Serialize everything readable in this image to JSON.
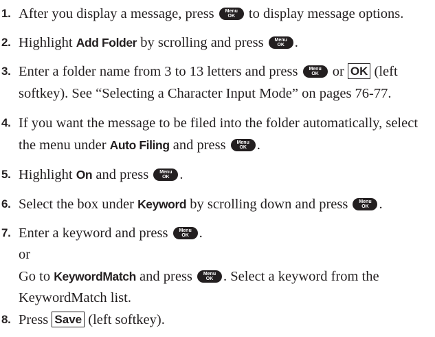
{
  "key": {
    "icon": "menu-ok-key-icon",
    "top": "Menu",
    "bottom": "OK"
  },
  "steps": [
    {
      "number": "1.",
      "t1": "After you display a message, press",
      "t2": "to display message options."
    },
    {
      "number": "2.",
      "t1": "Highlight",
      "bold1": "Add Folder",
      "t2": "by scrolling and press",
      "t3": "."
    },
    {
      "number": "3.",
      "t1": "Enter a folder name from 3 to 13 letters and press",
      "t2": "or",
      "softkey": "OK",
      "t3": "(left",
      "line2": "softkey). See “Selecting a Character Input Mode” on pages 76-77."
    },
    {
      "number": "4.",
      "line1": "If you want the message to be filed into the folder automatically, select",
      "t1": "the menu under",
      "bold1": "Auto Filing",
      "t2": "and press",
      "t3": "."
    },
    {
      "number": "5.",
      "t1": "Highlight",
      "bold1": "On",
      "t2": "and press",
      "t3": "."
    },
    {
      "number": "6.",
      "t1": "Select the box under",
      "bold1": "Keyword",
      "t2": "by scrolling down and press",
      "t3": "."
    },
    {
      "number": "7.",
      "t1": "Enter a keyword and press",
      "t2": ".",
      "or": "or",
      "t3": "Go to",
      "bold1": "KeywordMatch",
      "t4": "and press",
      "t5": ". Select a keyword from the",
      "line5": "KeywordMatch list."
    },
    {
      "number": "8.",
      "t1": "Press",
      "softkey": "Save",
      "t2": "(left softkey)."
    }
  ]
}
